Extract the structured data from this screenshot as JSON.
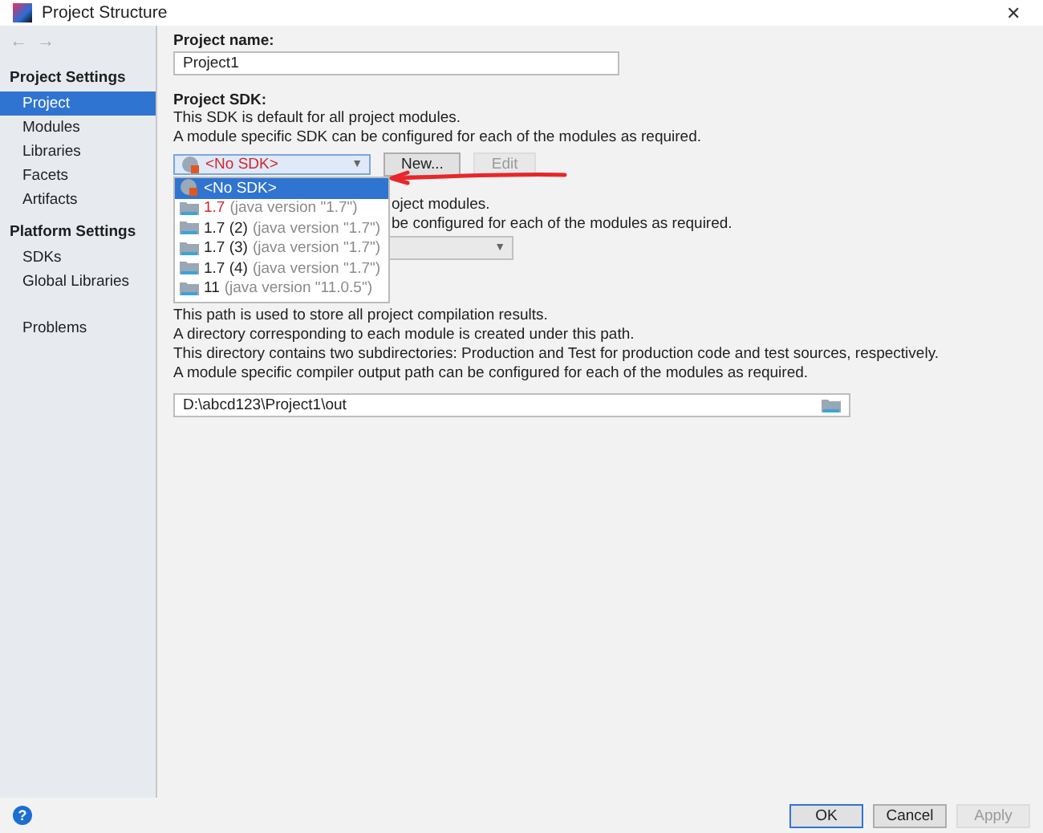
{
  "window": {
    "title": "Project Structure",
    "close": "✕"
  },
  "sidebar": {
    "nav": [
      "←",
      "→"
    ],
    "sections": [
      {
        "heading": "Project Settings",
        "items": [
          {
            "label": "Project",
            "selected": true
          },
          {
            "label": "Modules",
            "selected": false
          },
          {
            "label": "Libraries",
            "selected": false
          },
          {
            "label": "Facets",
            "selected": false
          },
          {
            "label": "Artifacts",
            "selected": false
          }
        ]
      },
      {
        "heading": "Platform Settings",
        "items": [
          {
            "label": "SDKs",
            "selected": false
          },
          {
            "label": "Global Libraries",
            "selected": false
          }
        ]
      }
    ],
    "extra_items": [
      {
        "label": "Problems",
        "selected": false
      }
    ]
  },
  "project_name": {
    "label": "Project name:",
    "value": "Project1"
  },
  "project_sdk": {
    "label": "Project SDK:",
    "description": [
      "This SDK is default for all project modules.",
      "A module specific SDK can be configured for each of the modules as required."
    ],
    "combo": {
      "value": "<No SDK>",
      "invalid": true,
      "caret": "▼"
    },
    "buttons": [
      {
        "label": "New...",
        "disabled": false
      },
      {
        "label": "Edit",
        "disabled": true
      }
    ],
    "dropdown": [
      {
        "name": "<No SDK>",
        "selected": true,
        "invalid": true,
        "kind": "none"
      },
      {
        "name": "1.7",
        "detail": "(java version \"1.7\")",
        "selected": false,
        "invalid": true,
        "kind": "sdk"
      },
      {
        "name": "1.7 (2)",
        "detail": "(java version \"1.7\")",
        "selected": false,
        "invalid": false,
        "kind": "sdk"
      },
      {
        "name": "1.7 (3)",
        "detail": "(java version \"1.7\")",
        "selected": false,
        "invalid": false,
        "kind": "sdk"
      },
      {
        "name": "1.7 (4)",
        "detail": "(java version \"1.7\")",
        "selected": false,
        "invalid": false,
        "kind": "sdk"
      },
      {
        "name": "11",
        "detail": "(java version \"11.0.5\")",
        "selected": false,
        "invalid": false,
        "kind": "sdk"
      }
    ]
  },
  "language_level": {
    "caret": "▼",
    "visible_lines": [
      "oject modules.",
      "be configured for each of the modules as required."
    ]
  },
  "compiler_output": {
    "description": [
      "This path is used to store all project compilation results.",
      "A directory corresponding to each module is created under this path.",
      "This directory contains two subdirectories: Production and Test for production code and test sources, respectively.",
      "A module specific compiler output path can be configured for each of the modules as required."
    ],
    "path": "D:\\abcd123\\Project1\\out"
  },
  "footer": {
    "help": "?",
    "buttons": [
      {
        "label": "OK",
        "default": true,
        "disabled": false
      },
      {
        "label": "Cancel",
        "default": false,
        "disabled": false
      },
      {
        "label": "Apply",
        "default": false,
        "disabled": true
      }
    ]
  }
}
